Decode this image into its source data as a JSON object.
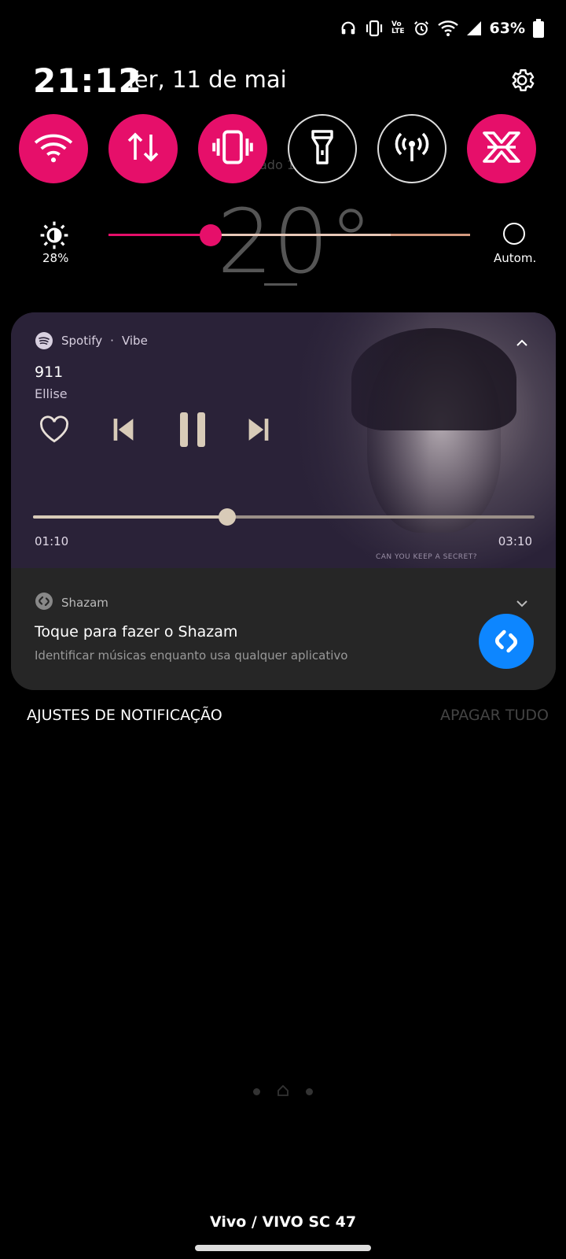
{
  "status_bar": {
    "battery_text": "63%",
    "icons": [
      "headset-icon",
      "vibrate-icon",
      "volte-icon",
      "alarm-icon",
      "wifi-icon",
      "signal-icon",
      "battery-icon"
    ],
    "volte_top": "Vo",
    "volte_bottom": "LTE"
  },
  "header": {
    "time": "21:12",
    "date": "Ter, 11 de mai"
  },
  "quick_tiles": [
    {
      "name": "wifi",
      "state": "on"
    },
    {
      "name": "mobile-data",
      "state": "on"
    },
    {
      "name": "vibrate",
      "state": "on"
    },
    {
      "name": "flashlight",
      "state": "off"
    },
    {
      "name": "hotspot",
      "state": "off"
    },
    {
      "name": "x-app",
      "state": "on"
    }
  ],
  "brightness": {
    "value_label": "28%",
    "level": 0.28,
    "auto_label": "Autom."
  },
  "background_widget": {
    "temperature": "20°",
    "updated_text": "ado 19:16"
  },
  "media": {
    "app_name": "Spotify",
    "separator": "·",
    "device": "Vibe",
    "song": "911",
    "artist": "Ellise",
    "elapsed": "01:10",
    "total": "03:10",
    "progress": 0.37,
    "art_caption": "CAN YOU KEEP A SECRET?"
  },
  "shazam": {
    "app_name": "Shazam",
    "title": "Toque para fazer o Shazam",
    "subtitle": "Identificar músicas enquanto usa qualquer aplicativo"
  },
  "footer": {
    "settings_label": "AJUSTES DE NOTIFICAÇÃO",
    "clear_label": "APAGAR TUDO",
    "carrier": "Vivo / VIVO SC 47"
  },
  "colors": {
    "accent": "#e60f6a",
    "media_bg": "#2a2238",
    "card_bg": "#262626",
    "shazam_blue": "#0d86ff"
  }
}
